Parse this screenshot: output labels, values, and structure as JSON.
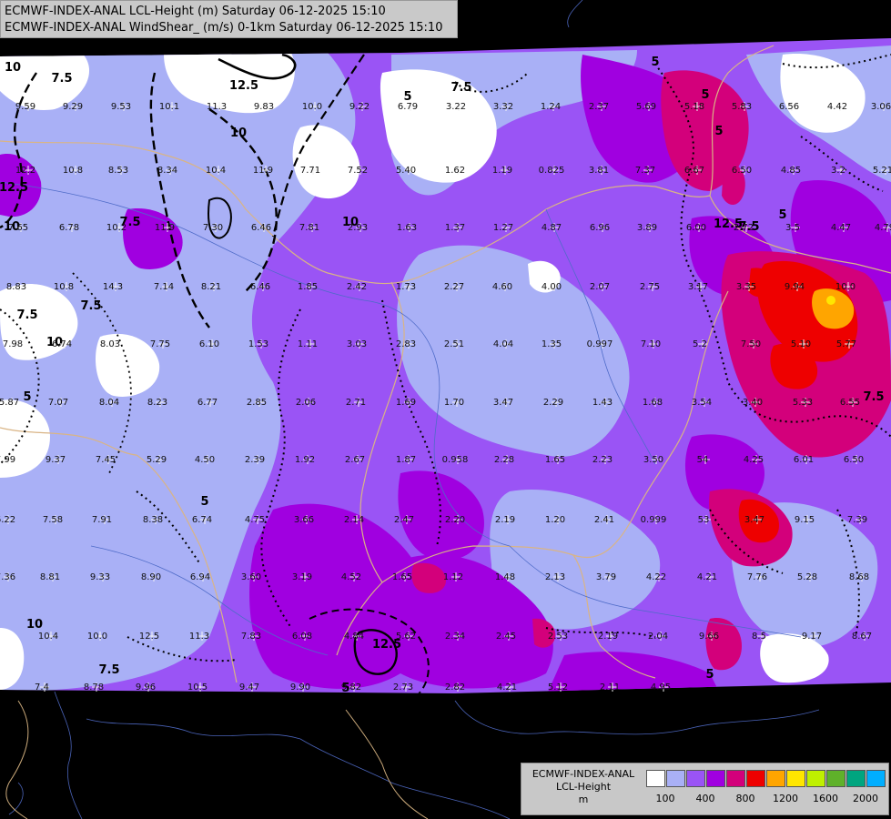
{
  "title": {
    "line1": "ECMWF-INDEX-ANAL LCL-Height (m) Saturday 06-12-2025 15:10",
    "line2": "ECMWF-INDEX-ANAL WindShear_ (m/s) 0-1km Saturday 06-12-2025 15:10"
  },
  "legend": {
    "title_line1": "ECMWF-INDEX-ANAL",
    "title_line2": "LCL-Height",
    "unit": "m",
    "colors": [
      "#ffffff",
      "#a9b0f6",
      "#9a54f5",
      "#a000e0",
      "#d3007b",
      "#ee0000",
      "#ffa500",
      "#ffe600",
      "#bff000",
      "#5fb12a",
      "#00a57f",
      "#00aeff"
    ],
    "ticks": [
      "100",
      "400",
      "800",
      "1200",
      "1600",
      "2000"
    ]
  },
  "contour_labels": [
    "10",
    "7.5",
    "12.5",
    "5",
    "10",
    "12.5",
    "7.5",
    "10",
    "7.5",
    "5",
    "5",
    "5",
    "7.5",
    "10",
    "12.5",
    "10",
    "7.5",
    "5",
    "12.5",
    "7.5",
    "7.5",
    "5",
    "5",
    "10",
    "5",
    "7.5",
    "5"
  ],
  "station_values": [
    "9.59",
    "9.29",
    "9.53",
    "10.1",
    "11.3",
    "9.83",
    "10.0",
    "9.22",
    "6.79",
    "3.22",
    "3.32",
    "1.24",
    "2.37",
    "5.69",
    "5.18",
    "5.83",
    "6.56",
    "4.42",
    "3.06",
    "12.2",
    "10.8",
    "8.53",
    "8.34",
    "10.4",
    "11.9",
    "7.71",
    "7.52",
    "5.40",
    "1.62",
    "1.19",
    "0.825",
    "3.81",
    "7.37",
    "6.67",
    "6.50",
    "4.85",
    "3.2",
    "5.21",
    "7.65",
    "6.78",
    "10.2",
    "11.9",
    "7.30",
    "6.46",
    "7.81",
    "2.93",
    "1.63",
    "1.37",
    "1.27",
    "4.87",
    "6.96",
    "3.89",
    "6.00",
    "2.72",
    "3.5",
    "4.47",
    "4.79",
    "8.83",
    "10.8",
    "14.3",
    "7.14",
    "8.21",
    "6.46",
    "1.85",
    "2.42",
    "1.73",
    "2.27",
    "4.60",
    "4.00",
    "2.07",
    "2.75",
    "3.17",
    "3.35",
    "9.94",
    "10.0",
    "7.98",
    "6.74",
    "8.03",
    "7.75",
    "6.10",
    "1.53",
    "1.11",
    "3.03",
    "2.83",
    "2.51",
    "4.04",
    "1.35",
    "0.997",
    "7.10",
    "5.2",
    "7.50",
    "5.10",
    "5.77",
    "5.87",
    "7.07",
    "8.04",
    "8.23",
    "6.77",
    "2.85",
    "2.06",
    "2.71",
    "1.69",
    "1.70",
    "3.47",
    "2.29",
    "1.43",
    "1.68",
    "3.54",
    "3.40",
    "5.33",
    "6.55",
    "7.99",
    "9.37",
    "7.45",
    "5.29",
    "4.50",
    "2.39",
    "1.92",
    "2.67",
    "1.87",
    "0.958",
    "2.28",
    "1.65",
    "2.23",
    "3.50",
    "54",
    "4.25",
    "6.01",
    "6.50",
    "6.22",
    "7.58",
    "7.91",
    "8.38",
    "6.74",
    "4.75",
    "3.66",
    "2.14",
    "2.47",
    "2.20",
    "2.19",
    "1.20",
    "2.41",
    "0.999",
    "53",
    "3.47",
    "9.15",
    "7.39",
    "7.36",
    "8.81",
    "9.33",
    "8.90",
    "6.94",
    "3.60",
    "3.19",
    "4.52",
    "1.65",
    "1.12",
    "1.48",
    "2.13",
    "3.79",
    "4.22",
    "4.21",
    "7.76",
    "5.28",
    "8.68",
    "10.4",
    "10.0",
    "12.5",
    "11.3",
    "7.83",
    "6.08",
    "4.84",
    "5.62",
    "2.34",
    "2.45",
    "2.53",
    "2.19",
    "2.04",
    "9.66",
    "8.5",
    "9.17",
    "8.67",
    "7.4",
    "8.78",
    "9.96",
    "10.5",
    "9.47",
    "9.90",
    "9.82",
    "2.73",
    "2.82",
    "4.21",
    "5.12",
    "2.11",
    "4.95"
  ]
}
